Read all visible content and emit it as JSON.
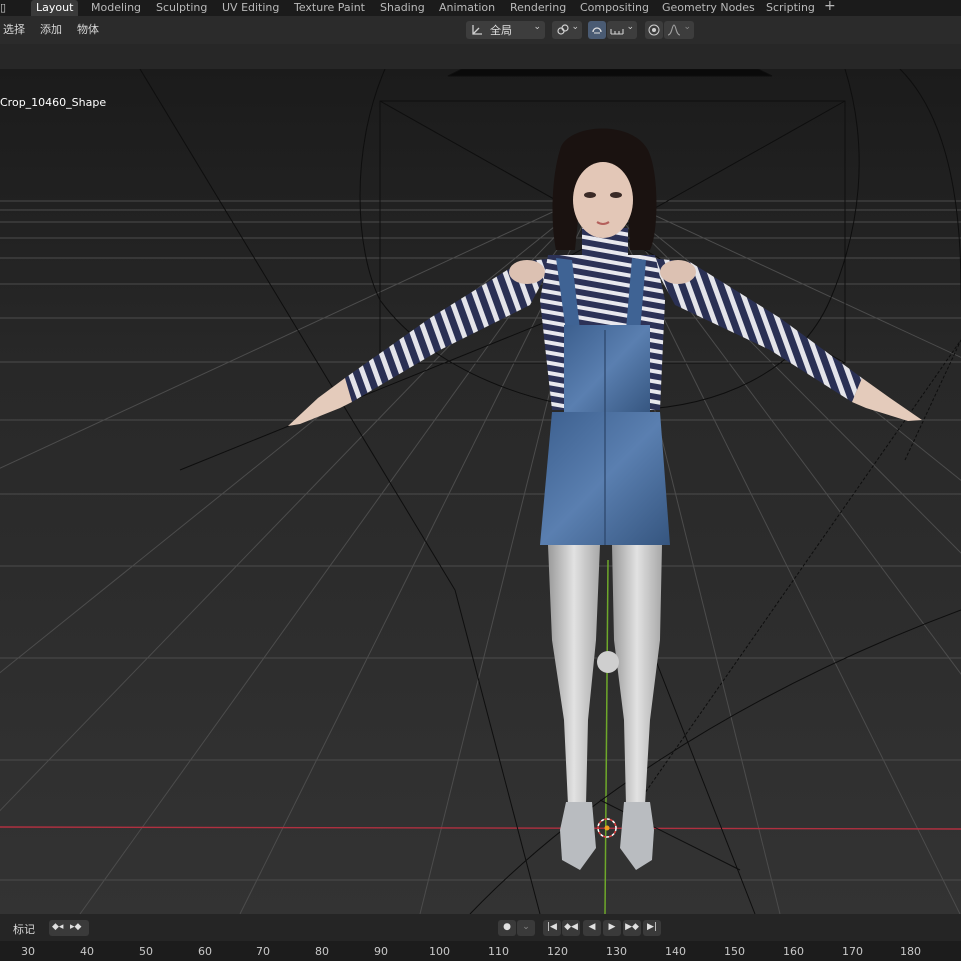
{
  "workspaces": [
    "Layout",
    "Modeling",
    "Sculpting",
    "UV Editing",
    "Texture Paint",
    "Shading",
    "Animation",
    "Rendering",
    "Compositing",
    "Geometry Nodes",
    "Scripting"
  ],
  "header": {
    "menu": [
      "选择",
      "添加",
      "物体"
    ],
    "orientation_label": "全局"
  },
  "viewport": {
    "object_name": "Crop_10460_Shape"
  },
  "timeline": {
    "markers_label": "标记",
    "ruler": [
      "30",
      "40",
      "50",
      "60",
      "70",
      "80",
      "90",
      "100",
      "110",
      "120",
      "130",
      "140",
      "150",
      "160",
      "170",
      "180"
    ]
  },
  "icons": {
    "add_workspace": "plus-icon",
    "transform_orientation": "axis-icon",
    "pivot": "link-icon",
    "snap": "magnet-icon",
    "snap_target": "increment-icon",
    "proportional": "circle-dot-icon",
    "falloff": "falloff-curve-icon",
    "keyframe_prev": "diamond-left-icon",
    "keyframe_next": "diamond-right-icon",
    "record": "record-icon",
    "jump_start": "jump-start-icon",
    "prev_key": "prev-key-icon",
    "play_reverse": "play-reverse-icon",
    "play": "play-icon",
    "next_key": "next-key-icon",
    "jump_end": "jump-end-icon"
  },
  "colors": {
    "accent_active_tab": "#3a3a3a",
    "x_axis": "#b03040",
    "y_axis": "#6ea82a",
    "grid": "#565656",
    "viewport_bg": "#3d3d3d"
  }
}
